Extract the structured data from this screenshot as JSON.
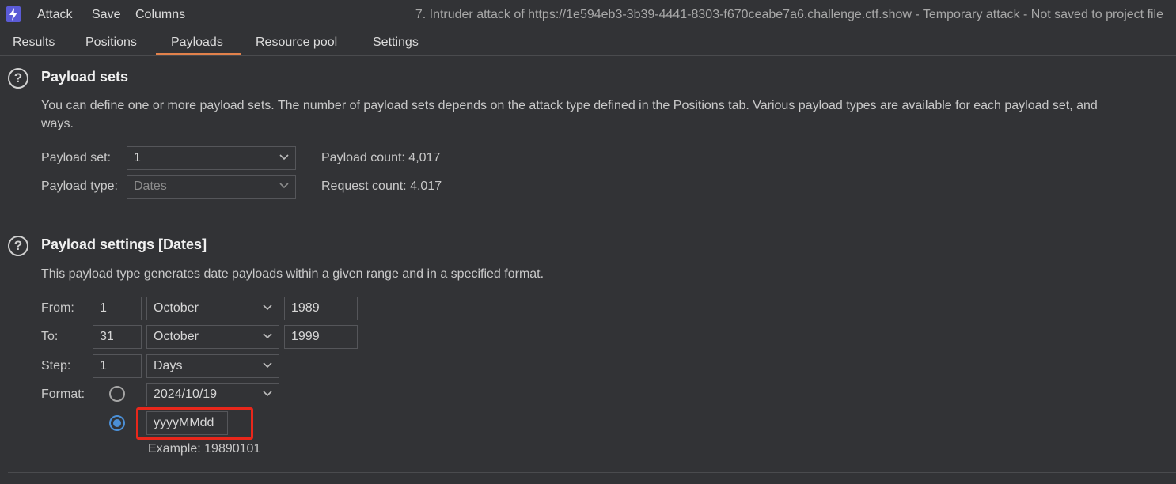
{
  "menubar": {
    "items": [
      "Attack",
      "Save",
      "Columns"
    ],
    "window_title": "7. Intruder attack of https://1e594eb3-3b39-4441-8303-f670ceabe7a6.challenge.ctf.show - Temporary attack - Not saved to project file"
  },
  "tabs": [
    {
      "label": "Results",
      "active": false
    },
    {
      "label": "Positions",
      "active": false
    },
    {
      "label": "Payloads",
      "active": true
    },
    {
      "label": "Resource pool",
      "active": false
    },
    {
      "label": "Settings",
      "active": false
    }
  ],
  "payload_sets": {
    "title": "Payload sets",
    "description_line1": "You can define one or more payload sets. The number of payload sets depends on the attack type defined in the Positions tab. Various payload types are available for each payload set, and",
    "description_line2": "ways.",
    "set_label": "Payload set:",
    "set_value": "1",
    "type_label": "Payload type:",
    "type_value": "Dates",
    "payload_count": "Payload count: 4,017",
    "request_count": "Request count: 4,017"
  },
  "payload_settings": {
    "title": "Payload settings [Dates]",
    "description": "This payload type generates date payloads within a given range and in a specified format.",
    "from_label": "From:",
    "from_day": "1",
    "from_month": "October",
    "from_year": "1989",
    "to_label": "To:",
    "to_day": "31",
    "to_month": "October",
    "to_year": "1999",
    "step_label": "Step:",
    "step_value": "1",
    "step_unit": "Days",
    "format_label": "Format:",
    "format_preset": "2024/10/19",
    "format_custom": "yyyyMMdd",
    "example": "Example: 19890101"
  },
  "colors": {
    "background": "#323336",
    "accent_tab": "#e2814b",
    "radio_selected": "#4b8fd6",
    "highlight_box": "#e8271b",
    "app_icon": "#5b5bd6"
  }
}
